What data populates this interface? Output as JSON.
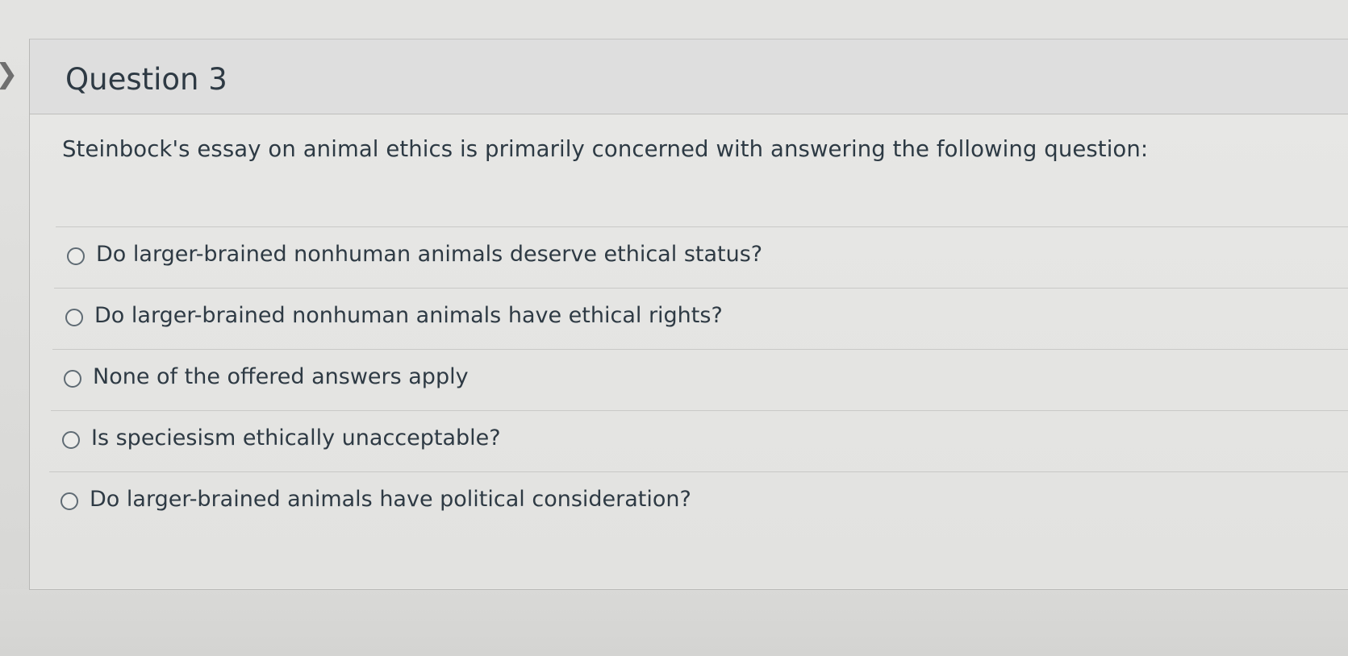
{
  "question": {
    "title": "Question 3",
    "text": "Steinbock's essay on animal ethics is primarily concerned with answering the following question:",
    "answers": [
      {
        "label": "Do larger-brained nonhuman animals deserve ethical status?",
        "selected": false
      },
      {
        "label": "Do larger-brained nonhuman animals have ethical rights?",
        "selected": false
      },
      {
        "label": "None of the offered answers apply",
        "selected": false
      },
      {
        "label": "Is speciesism ethically unacceptable?",
        "selected": false
      },
      {
        "label": "Do larger-brained animals have political consideration?",
        "selected": false
      }
    ]
  },
  "icons": {
    "collapse": "chevron-right-icon",
    "radio": "radio-button-icon"
  },
  "colors": {
    "text": "#2d3b45",
    "background": "#e4e4e2",
    "divider": "#c9c9c7"
  }
}
